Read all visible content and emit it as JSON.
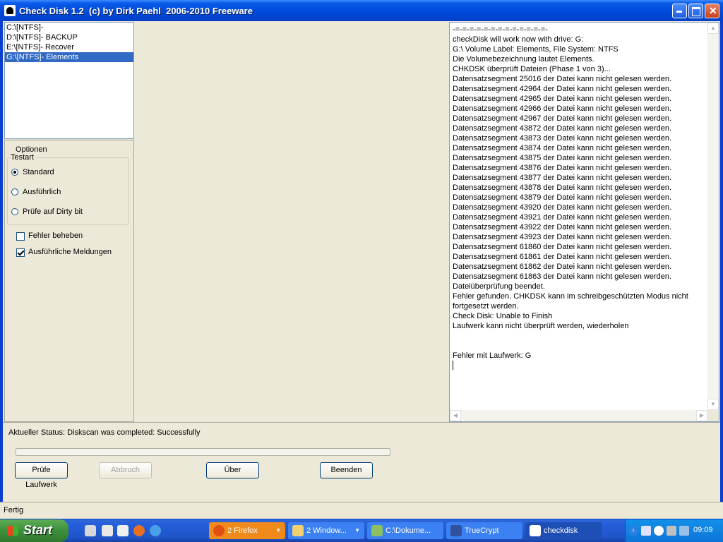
{
  "window": {
    "title": "Check Disk 1.2  (c) by Dirk Paehl  2006-2010 Freeware"
  },
  "drives": [
    {
      "label": "C:\\[NTFS]-",
      "selected": false
    },
    {
      "label": "D:\\[NTFS]- BACKUP",
      "selected": false
    },
    {
      "label": "E:\\[NTFS]- Recover",
      "selected": false
    },
    {
      "label": "G:\\[NTFS]- Elements",
      "selected": true
    }
  ],
  "options": {
    "title": "Optionen",
    "testart_label": "Testart",
    "radios": [
      {
        "label": "Standard",
        "checked": true
      },
      {
        "label": "Ausführlich",
        "checked": false
      },
      {
        "label": "Prüfe auf Dirty bit",
        "checked": false
      }
    ],
    "checkboxes": [
      {
        "label": "Fehler beheben",
        "checked": false
      },
      {
        "label": "Ausführliche Meldungen",
        "checked": true
      }
    ]
  },
  "log": {
    "lines": [
      "-=-=-=-=-=-=-=-=-=-=-=-=-=-",
      "checkDisk will work now with drive: G:",
      "G:\\ Volume Label: Elements, File System: NTFS",
      "Die Volumebezeichnung lautet Elements.",
      "CHKDSK überprüft Dateien (Phase 1 von 3)...",
      "Datensatzsegment 25016 der Datei kann nicht gelesen werden.",
      "Datensatzsegment 42964 der Datei kann nicht gelesen werden.",
      "Datensatzsegment 42965 der Datei kann nicht gelesen werden.",
      "Datensatzsegment 42966 der Datei kann nicht gelesen werden.",
      "Datensatzsegment 42967 der Datei kann nicht gelesen werden.",
      "Datensatzsegment 43872 der Datei kann nicht gelesen werden.",
      "Datensatzsegment 43873 der Datei kann nicht gelesen werden.",
      "Datensatzsegment 43874 der Datei kann nicht gelesen werden.",
      "Datensatzsegment 43875 der Datei kann nicht gelesen werden.",
      "Datensatzsegment 43876 der Datei kann nicht gelesen werden.",
      "Datensatzsegment 43877 der Datei kann nicht gelesen werden.",
      "Datensatzsegment 43878 der Datei kann nicht gelesen werden.",
      "Datensatzsegment 43879 der Datei kann nicht gelesen werden.",
      "Datensatzsegment 43920 der Datei kann nicht gelesen werden.",
      "Datensatzsegment 43921 der Datei kann nicht gelesen werden.",
      "Datensatzsegment 43922 der Datei kann nicht gelesen werden.",
      "Datensatzsegment 43923 der Datei kann nicht gelesen werden.",
      "Datensatzsegment 61860 der Datei kann nicht gelesen werden.",
      "Datensatzsegment 61861 der Datei kann nicht gelesen werden.",
      "Datensatzsegment 61862 der Datei kann nicht gelesen werden.",
      "Datensatzsegment 61863 der Datei kann nicht gelesen werden.",
      "Dateiüberprüfung beendet.",
      "Fehler gefunden. CHKDSK kann im schreibgeschützten Modus nicht fortgesetzt werden.",
      "Check Disk: Unable to Finish",
      "Laufwerk kann nicht überprüft werden, wiederholen",
      "",
      "",
      "Fehler mit Laufwerk: G"
    ]
  },
  "status": {
    "text": "Aktueller Status: Diskscan was completed: Successfully",
    "progress": 0
  },
  "buttons": {
    "check": "Prüfe Laufwerk",
    "abort": "Abbruch",
    "about": "Über",
    "quit": "Beenden"
  },
  "statusbar": {
    "text": "Fertig"
  },
  "taskbar": {
    "start": "Start",
    "tasks": [
      {
        "label": "2 Firefox",
        "icon": "firefox-icon",
        "group": true
      },
      {
        "label": "2 Window...",
        "icon": "folder-icon",
        "group": true
      },
      {
        "label": "C:\\Dokume...",
        "icon": "explorer-icon",
        "group": false
      },
      {
        "label": "TrueCrypt",
        "icon": "truecrypt-icon",
        "group": false
      },
      {
        "label": "checkdisk",
        "icon": "checkdisk-icon",
        "group": false
      }
    ],
    "clock": "09:09"
  }
}
